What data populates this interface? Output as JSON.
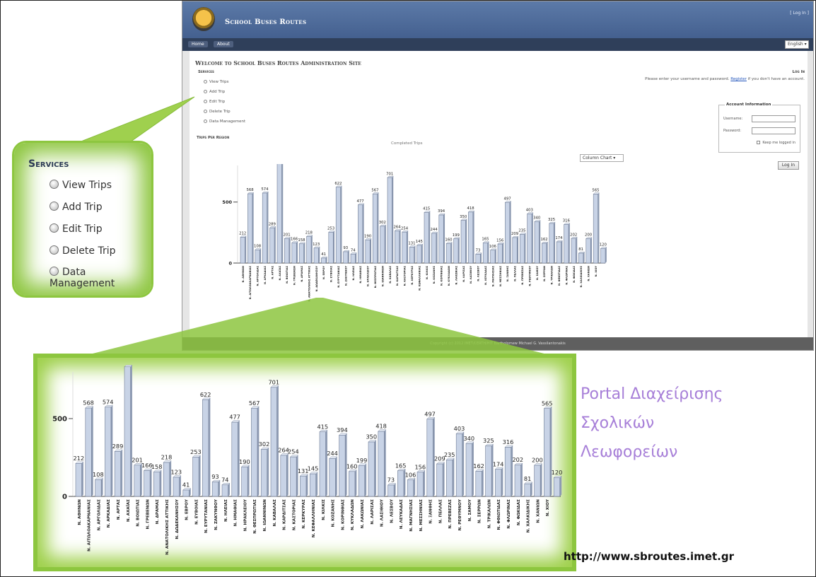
{
  "app": {
    "title": "School Buses Routes",
    "login_link": "[ Log In ]",
    "nav": [
      "Home",
      "About"
    ],
    "language": "English",
    "welcome": "Welcome to School Buses Routes Administration Site",
    "services_heading": "Services",
    "services": [
      "View Trips",
      "Add Trip",
      "Edit Trip",
      "Delete Trip",
      "Data Management"
    ],
    "trips_heading": "Trips Per Region",
    "chart_select": "Column Chart",
    "login": {
      "heading": "Log In",
      "prompt": "Please enter your username and password.",
      "register": "Register",
      "prompt_tail": "if you don't have an account.",
      "legend": "Account Information",
      "username_label": "Username:",
      "password_label": "Password:",
      "keep_label": "Keep me logged in",
      "button": "Log In"
    },
    "footer": "Copyright (c) 2012 IMET/CERTH/HIT Bartholomew Michael G. Vassilantonakis"
  },
  "callout": {
    "title": "Services",
    "items": [
      "View Trips",
      "Add Trip",
      "Edit Trip",
      "Delete Trip",
      "Data Management"
    ]
  },
  "portal_text": [
    "Portal Διαχείρισης",
    "Σχολικών",
    "Λεωφορείων"
  ],
  "url": "http://www.sbroutes.imet.gr",
  "colors": {
    "accent_green": "#8dc63f",
    "header_blue": "#4a6897",
    "portal_purple": "#a77fd8",
    "bar_fill": "#c8d3e6"
  },
  "chart_data": {
    "type": "bar",
    "title": "Completed Trips",
    "xlabel": "",
    "ylabel": "",
    "ytick_labels": [
      "0",
      "500"
    ],
    "ylim": [
      0,
      800
    ],
    "categories": [
      "Ν. ΑΘΗΝΩΝ",
      "Ν. ΑΙΤΩΛΟΑΚΑΡΝΑΝΙΑΣ",
      "Ν. ΑΡΓΟΛΙΔΑΣ",
      "Ν. ΑΡΚΑΔΙΑΣ",
      "Ν. ΑΡΤΑΣ",
      "Ν. ΑΧΑΪΑΣ",
      "Ν. ΒΟΙΩΤΙΑΣ",
      "Ν. ΓΡΕΒΕΝΩΝ",
      "Ν. ΔΡΑΜΑΣ",
      "Ν. ΑΝΑΤΟΛΙΚΗΣ ΑΤΤΙΚΗΣ",
      "Ν. ΔΩΔΕΚΑΝΗΣΟΥ",
      "Ν. ΕΒΡΟΥ",
      "Ν. ΕΥΒΟΙΑΣ",
      "Ν. ΕΥΡΥΤΑΝΙΑΣ",
      "Ν. ΖΑΚΥΝΘΟΥ",
      "Ν. ΗΛΕΙΑΣ",
      "Ν. ΗΜΑΘΙΑΣ",
      "Ν. ΗΡΑΚΛΕΙΟΥ",
      "Ν. ΘΕΣΠΡΩΤΙΑΣ",
      "Ν. ΙΩΑΝΝΙΝΩΝ",
      "Ν. ΚΑΒΑΛΑΣ",
      "Ν. ΚΑΡΔΙΤΣΑΣ",
      "Ν. ΚΑΣΤΟΡΙΑΣ",
      "Ν. ΚΕΡΚΥΡΑΣ",
      "Ν. ΚΕΦΑΛΛΗΝΙΑΣ",
      "Ν. ΚΙΛΚΙΣ",
      "Ν. ΚΟΖΑΝΗΣ",
      "Ν. ΚΟΡΙΝΘΙΑΣ",
      "Ν. ΚΥΚΛΑΔΩΝ",
      "Ν. ΛΑΚΩΝΙΑΣ",
      "Ν. ΛΑΡΙΣΑΣ",
      "Ν. ΛΑΣΙΘΙΟΥ",
      "Ν. ΛΕΣΒΟΥ",
      "Ν. ΛΕΥΚΑΔΑΣ",
      "Ν. ΜΑΓΝΗΣΙΑΣ",
      "Ν. ΜΕΣΣΗΝΙΑΣ",
      "Ν. ΞΑΝΘΗΣ",
      "Ν. ΠΕΛΛΑΣ",
      "Ν. ΠΡΕΒΕΖΑΣ",
      "Ν. ΡΕΘΥΜΝΟΥ",
      "Ν. ΣΑΜΟΥ",
      "Ν. ΣΕΡΡΩΝ",
      "Ν. ΤΡΙΚΑΛΩΝ",
      "Ν. ΦΘΙΩΤΙΔΑΣ",
      "Ν. ΦΛΩΡΙΝΑΣ",
      "Ν. ΦΩΚΙΔΑΣ",
      "Ν. ΧΑΛΚΙΔΙΚΗΣ",
      "Ν. ΧΑΝΙΩΝ",
      "Ν. ΧΙΟΥ"
    ],
    "values": [
      212,
      568,
      108,
      574,
      289,
      833,
      201,
      166,
      158,
      218,
      123,
      41,
      253,
      622,
      93,
      74,
      477,
      190,
      567,
      302,
      701,
      264,
      254,
      131,
      145,
      415,
      244,
      394,
      160,
      199,
      350,
      418,
      73,
      165,
      106,
      156,
      497,
      209,
      235,
      403,
      340,
      162,
      325,
      174,
      316,
      202,
      81,
      200,
      565,
      120
    ]
  }
}
